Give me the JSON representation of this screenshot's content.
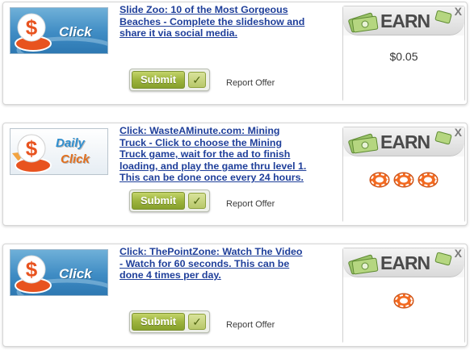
{
  "offers": [
    {
      "thumb_type": "click",
      "thumb_words": [
        "Click"
      ],
      "description": "Slide Zoo: 10 of the Most Gorgeous Beaches - Complete the slideshow and share it via social media.",
      "submit_label": "Submit",
      "report_label": "Report Offer",
      "earn_label": "EARN",
      "close_label": "X",
      "reward_text": "$0.05",
      "reward_chips": 0
    },
    {
      "thumb_type": "daily",
      "thumb_words": [
        "Daily",
        "Click"
      ],
      "description": "Click: WasteAMinute.com: Mining Truck - Click to choose the Mining Truck game, wait for the ad to finish loading, and play the game thru level 1. This can be done once every 24 hours.",
      "submit_label": "Submit",
      "report_label": "Report Offer",
      "earn_label": "EARN",
      "close_label": "X",
      "reward_text": "",
      "reward_chips": 3
    },
    {
      "thumb_type": "click",
      "thumb_words": [
        "Click"
      ],
      "description": "Click: ThePointZone: Watch The Video - Watch for 60 seconds. This can be done 4 times per day.",
      "submit_label": "Submit",
      "report_label": "Report Offer",
      "earn_label": "EARN",
      "close_label": "X",
      "reward_text": "",
      "reward_chips": 1
    }
  ],
  "icons": {
    "thumb": "dollar-click-icon",
    "money": "money-stack-icon",
    "check": "check-icon",
    "chip": "poker-chip-icon"
  },
  "colors": {
    "link": "#1f3f9a",
    "submit_green": "#9db43e",
    "chip_orange": "#f26a21",
    "thumb_blue": "#3f8cc4"
  }
}
